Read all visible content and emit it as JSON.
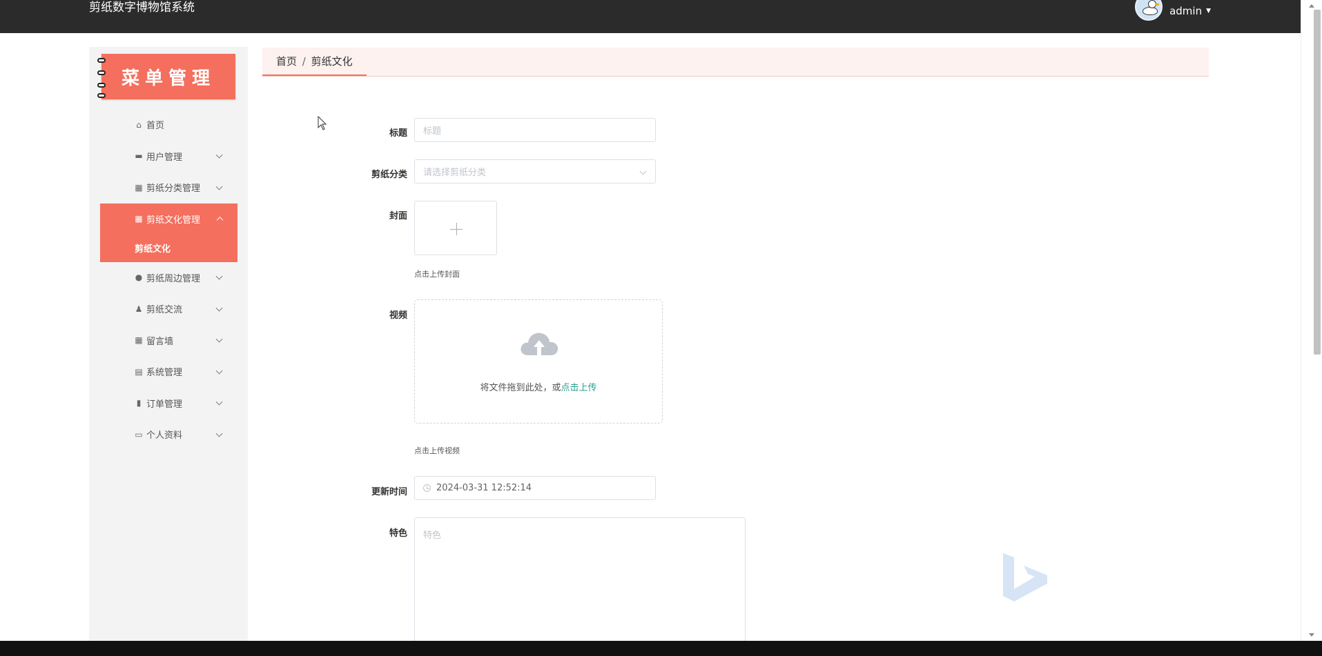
{
  "header": {
    "app_title": "剪纸数字博物馆系统",
    "username": "admin"
  },
  "sidebar": {
    "header_title": "菜单管理",
    "items": [
      {
        "label": "首页",
        "icon": "home-icon"
      },
      {
        "label": "用户管理",
        "icon": "briefcase-icon"
      },
      {
        "label": "剪纸分类管理",
        "icon": "grid-icon"
      },
      {
        "label": "剪纸文化管理",
        "icon": "grid-icon",
        "sub": [
          "剪纸文化"
        ]
      },
      {
        "label": "剪纸周边管理",
        "icon": "user-icon"
      },
      {
        "label": "剪纸交流",
        "icon": "user-small-icon"
      },
      {
        "label": "留言墙",
        "icon": "grid-icon"
      },
      {
        "label": "系统管理",
        "icon": "clipboard-icon"
      },
      {
        "label": "订单管理",
        "icon": "bar-chart-icon"
      },
      {
        "label": "个人资料",
        "icon": "card-icon"
      }
    ]
  },
  "breadcrumb": {
    "home": "首页",
    "separator": "/",
    "current": "剪纸文化"
  },
  "form": {
    "title_label": "标题",
    "title_placeholder": "标题",
    "category_label": "剪纸分类",
    "category_placeholder": "请选择剪纸分类",
    "cover_label": "封面",
    "cover_hint": "点击上传封面",
    "video_label": "视频",
    "video_drag_text": "将文件拖到此处，或",
    "video_drag_link": "点击上传",
    "video_hint": "点击上传视频",
    "update_time_label": "更新时间",
    "update_time_value": "2024-03-31 12:52:14",
    "feature_label": "特色",
    "feature_placeholder": "特色"
  },
  "colors": {
    "accent": "#f46f5d",
    "topbar": "#2b2b2b",
    "link": "#2a9d8f"
  }
}
